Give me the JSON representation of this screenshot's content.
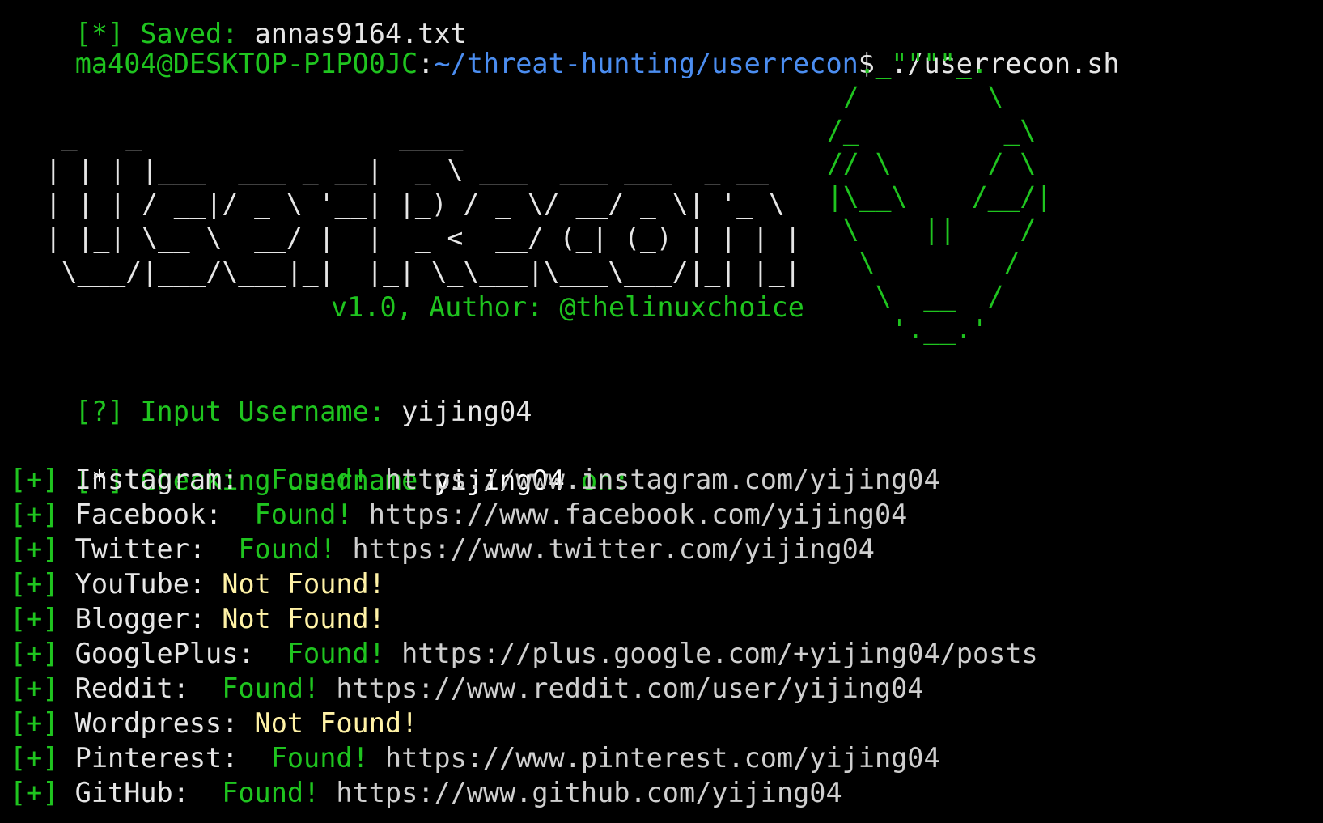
{
  "colors": {
    "background": "#000000",
    "green": "#1fc41f",
    "path_blue": "#4b8df0",
    "not_found_yellow": "#fff2a6",
    "text": "#e6e6e6"
  },
  "top_partial": {
    "bracket": "[*]",
    "label": " Saved: ",
    "value": "annas9164.txt"
  },
  "prompt": {
    "user_host": "ma404@DESKTOP-P1PO0JC",
    "colon": ":",
    "path": "~/threat-hunting/userrecon",
    "dollar": "$",
    "command": " ./userrecon.sh"
  },
  "banner": {
    "logo_art": "  _   _                ____\n | | | |___  ___ _ __|  _ \\ ___  ___ ___  _ __\n | | | / __|/ _ \\ '__| |_) / _ \\/ __/ _ \\| '_ \\\n | |_| \\__ \\  __/ |  |  _ <  __/ (_| (_) | | | |\n  \\___/|___/\\___|_|  |_| \\_\\___|\\___\\___/|_| |_|",
    "mask_art": "  ._\"\"\"\"_.\n /        \\\n/_         _\\\n// \\      / \\\n|\\__\\    /__/|\n \\    ||    /\n  \\        /\n   \\  __  /\n    '.__.'",
    "version_line": "v1.0, Author: @thelinuxchoice"
  },
  "input": {
    "bracket": "[?]",
    "label": " Input Username: ",
    "value": "yijing04"
  },
  "checking": {
    "bracket_open": "[",
    "star": "*",
    "bracket_close": "]",
    "label": " Checking username ",
    "username": "yijing04",
    "suffix": " on:"
  },
  "results": [
    {
      "bracket": "[+]",
      "site": " Instagram: ",
      "status": " Found!",
      "url": " https://www.instagram.com/yijing04",
      "found": true
    },
    {
      "bracket": "[+]",
      "site": " Facebook: ",
      "status": " Found!",
      "url": " https://www.facebook.com/yijing04",
      "found": true
    },
    {
      "bracket": "[+]",
      "site": " Twitter: ",
      "status": " Found!",
      "url": " https://www.twitter.com/yijing04",
      "found": true
    },
    {
      "bracket": "[+]",
      "site": " YouTube: ",
      "status": "Not Found!",
      "url": "",
      "found": false
    },
    {
      "bracket": "[+]",
      "site": " Blogger: ",
      "status": "Not Found!",
      "url": "",
      "found": false
    },
    {
      "bracket": "[+]",
      "site": " GooglePlus: ",
      "status": " Found!",
      "url": " https://plus.google.com/+yijing04/posts",
      "found": true
    },
    {
      "bracket": "[+]",
      "site": " Reddit: ",
      "status": " Found!",
      "url": " https://www.reddit.com/user/yijing04",
      "found": true
    },
    {
      "bracket": "[+]",
      "site": " Wordpress: ",
      "status": "Not Found!",
      "url": "",
      "found": false
    },
    {
      "bracket": "[+]",
      "site": " Pinterest: ",
      "status": " Found!",
      "url": " https://www.pinterest.com/yijing04",
      "found": true
    },
    {
      "bracket": "[+]",
      "site": " GitHub: ",
      "status": " Found!",
      "url": " https://www.github.com/yijing04",
      "found": true
    }
  ]
}
